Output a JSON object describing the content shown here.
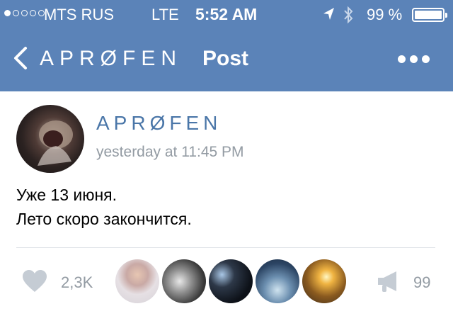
{
  "status_bar": {
    "signal_dots_filled": 1,
    "signal_dots_total": 5,
    "carrier": "MTS RUS",
    "network": "LTE",
    "time": "5:52 AM",
    "location_icon": "location-arrow-icon",
    "bluetooth_icon": "bluetooth-icon",
    "battery_percent": "99 %"
  },
  "nav": {
    "back_icon": "chevron-left-icon",
    "page_name": "APRØFEN",
    "title": "Post",
    "more_icon": "ellipsis-icon"
  },
  "post": {
    "author": "APRØFEN",
    "timestamp": "yesterday at 11:45 PM",
    "lines": [
      "Уже 13 июня.",
      "Лето скоро закончится."
    ]
  },
  "footer": {
    "likes_count": "2,3K",
    "shares_count": "99",
    "liker_avatars": [
      "avatar-1",
      "avatar-2",
      "avatar-3",
      "avatar-4",
      "avatar-5"
    ]
  },
  "colors": {
    "header_bg": "#5b83b8",
    "author_name": "#4a76a8",
    "muted_text": "#939ba3"
  }
}
